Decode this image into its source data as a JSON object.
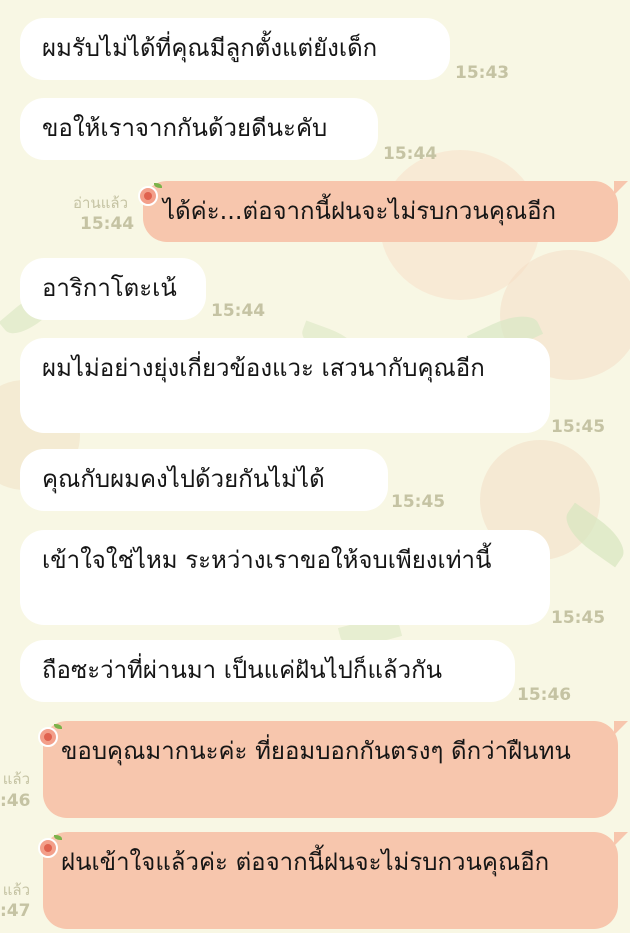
{
  "messages": [
    {
      "text": "ผมรับไม่ได้ที่คุณมีลูกตั้งแต่ยังเด็ก",
      "time": "15:43"
    },
    {
      "text": "ขอให้เราจากกันด้วยดีนะคับ",
      "time": "15:44"
    },
    {
      "text": "ได้ค่ะ...ต่อจากนี้ฝนจะไม่รบกวนคุณอีก",
      "time": "15:44",
      "read": "อ่านแล้ว"
    },
    {
      "text": "อาริกาโตะเน้",
      "time": "15:44"
    },
    {
      "text": "ผมไม่อย่างยุ่งเกี่ยวข้องแวะ เสวนากับคุณอีก",
      "time": "15:45"
    },
    {
      "text": "คุณกับผมคงไปด้วยกันไม่ได้",
      "time": "15:45"
    },
    {
      "text": "เข้าใจใช่ไหม ระหว่างเราขอให้จบเพียงเท่านี้",
      "time": "15:45"
    },
    {
      "text": "ถือซะว่าที่ผ่านมา เป็นแค่ฝันไปก็แล้วกัน",
      "time": "15:46"
    },
    {
      "text": "ขอบคุณมากนะค่ะ ที่ยอมบอกกันตรงๆ ดีกว่าฝืนทน",
      "time": ":46",
      "read": "แล้ว"
    },
    {
      "text": "ฝนเข้าใจแล้วค่ะ ต่อจากนี้ฝนจะไม่รบกวนคุณอีก",
      "time": ":47",
      "read": "แล้ว"
    }
  ],
  "colors": {
    "background": "#f8f7e4",
    "incoming_bubble": "#ffffff",
    "outgoing_bubble": "#f7c6ad",
    "timestamp": "#c5c3a3"
  }
}
